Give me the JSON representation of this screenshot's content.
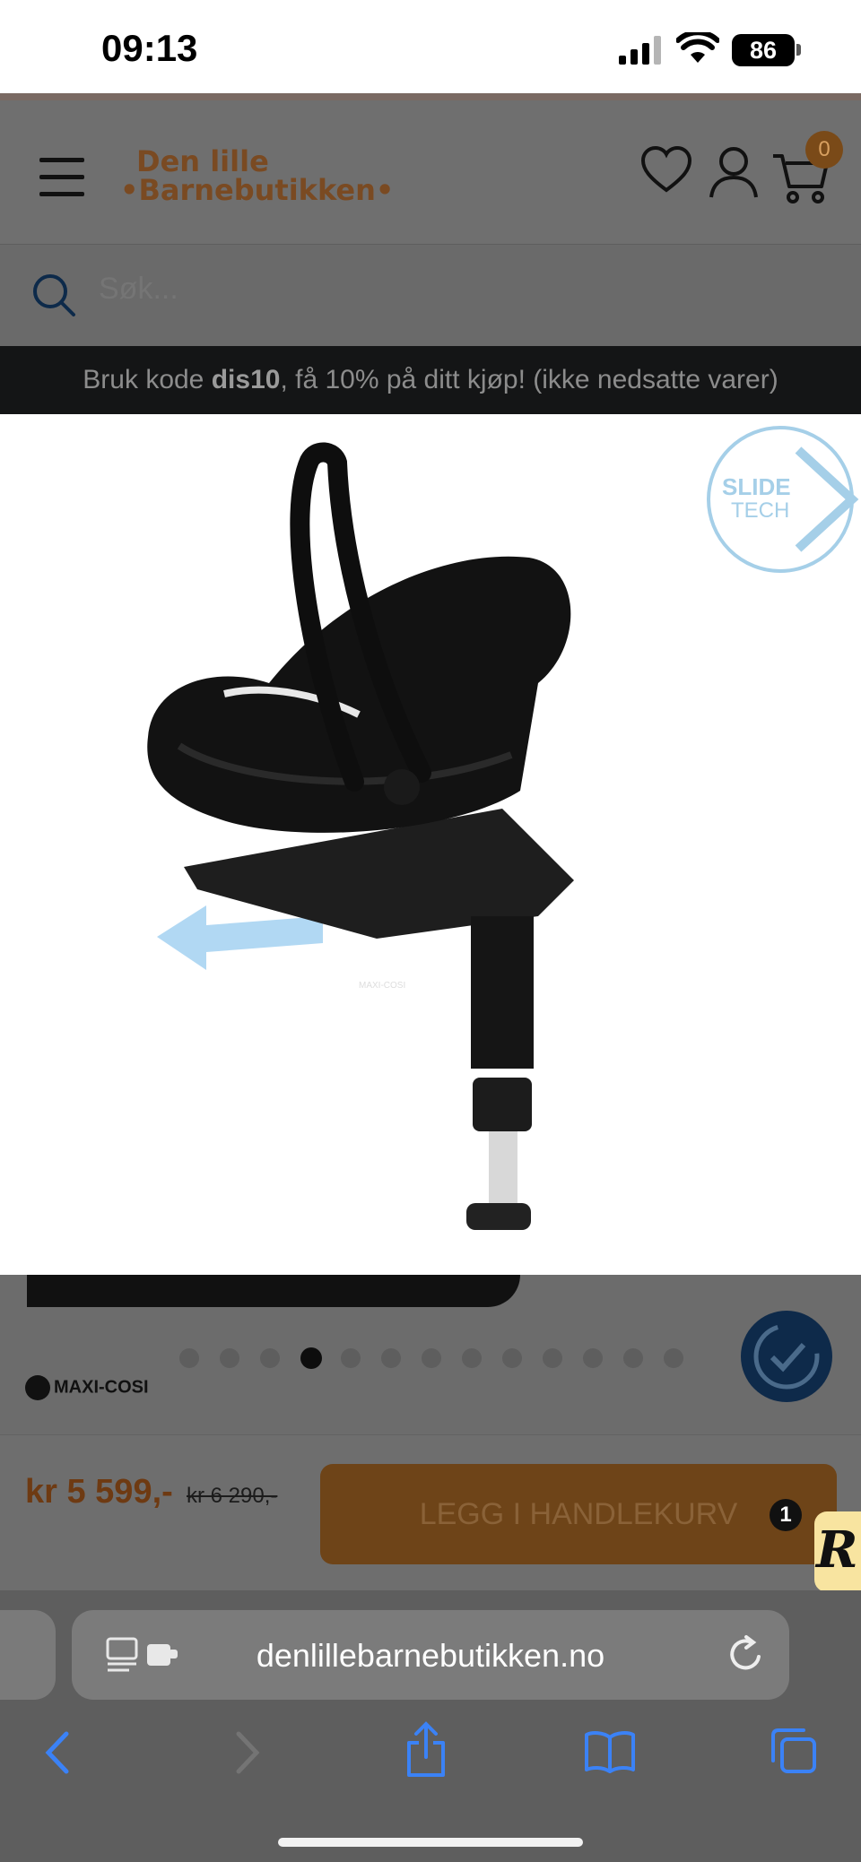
{
  "status_bar": {
    "time": "09:13",
    "battery": "86"
  },
  "header": {
    "logo_line1": "Den lille",
    "logo_line2": "•Barnebutikken•",
    "cart_count": "0"
  },
  "search": {
    "placeholder": "Søk..."
  },
  "promo": {
    "prefix": "Bruk kode ",
    "code": "dis10",
    "suffix": ", få 10% på ditt kjøp! (ikke nedsatte varer)"
  },
  "product_image": {
    "badge_line1": "SLIDE",
    "badge_line2": "TECH",
    "brand_marks": [
      "MAXI-COSI",
      "MAXI-COSI"
    ]
  },
  "carousel": {
    "total": 13,
    "active_index": 3
  },
  "brand": {
    "name": "MAXI-COSI"
  },
  "buy": {
    "price": "kr 5 599,-",
    "old_price": "kr 6 290,-",
    "add_to_cart": "LEGG I HANDLEKURV"
  },
  "reviews_widget": {
    "count": "1",
    "letter": "R"
  },
  "browser": {
    "url": "denlillebarnebutikken.no"
  },
  "colors": {
    "accent": "#c57a2b",
    "promo_bg": "#141516",
    "safari_icon": "#3b82f6"
  }
}
